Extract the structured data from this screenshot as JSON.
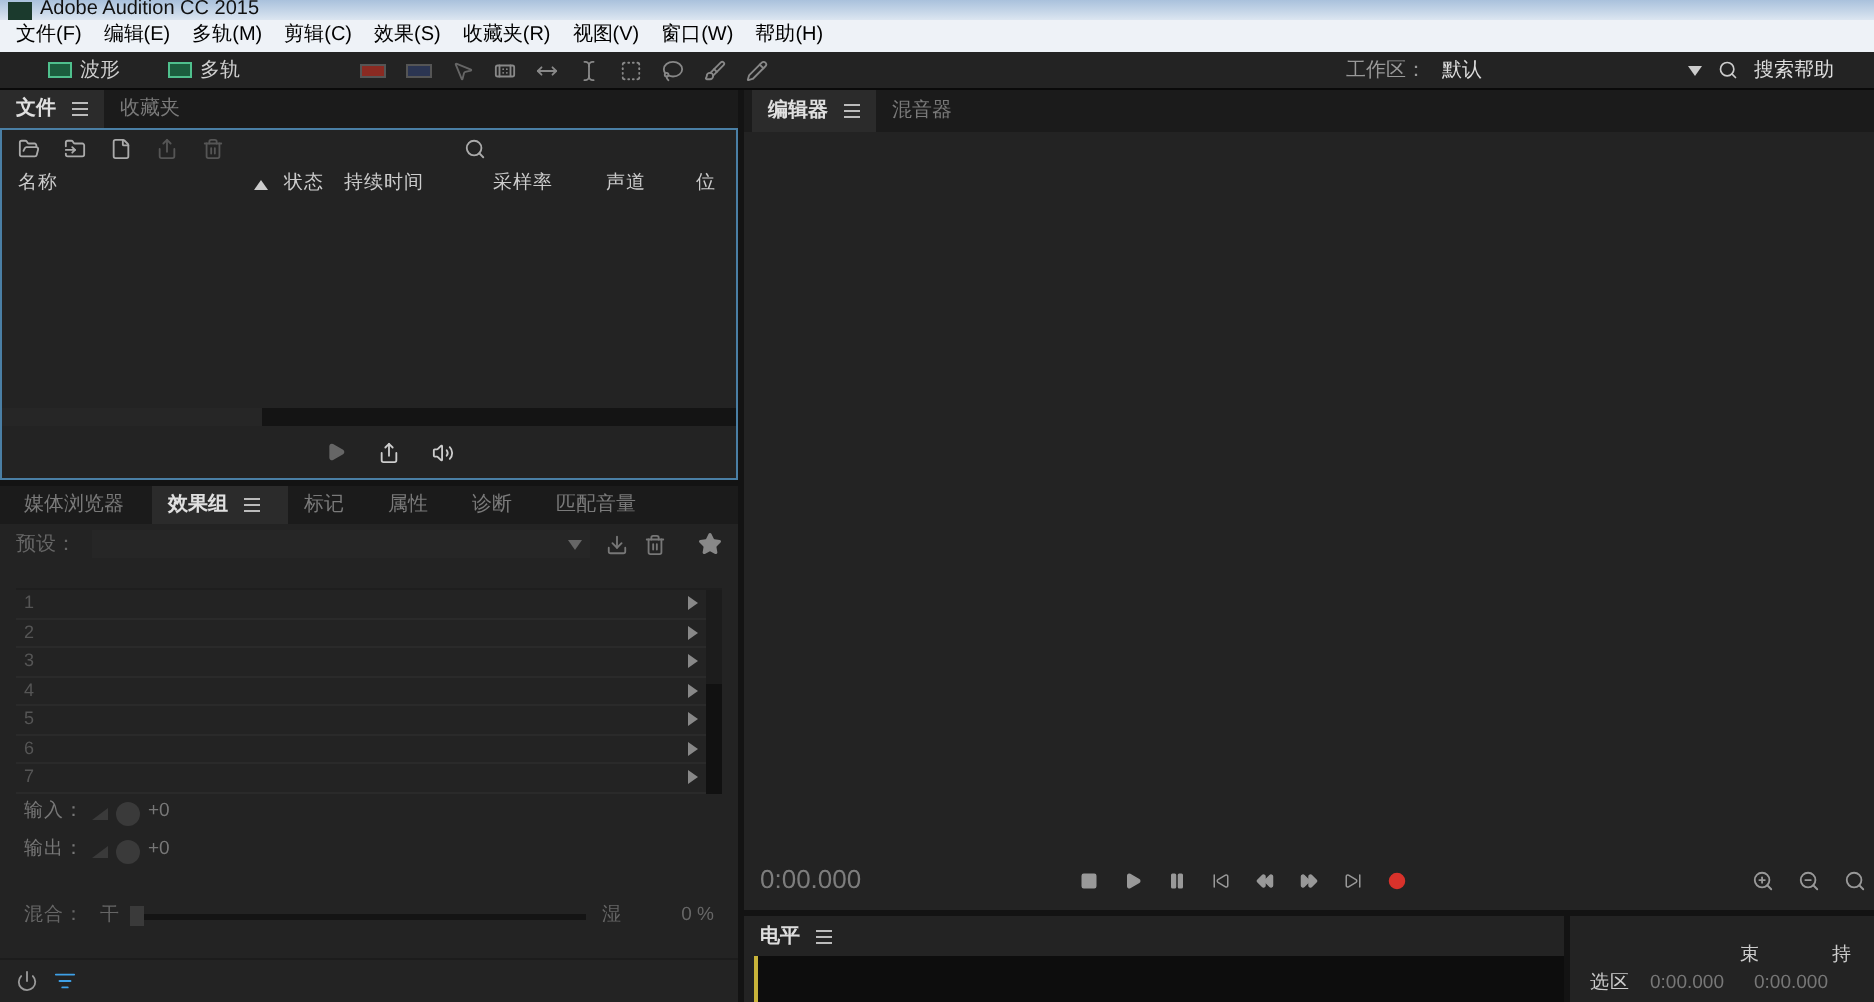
{
  "window": {
    "title": "Adobe Audition CC 2015"
  },
  "menu": [
    "文件(F)",
    "编辑(E)",
    "多轨(M)",
    "剪辑(C)",
    "效果(S)",
    "收藏夹(R)",
    "视图(V)",
    "窗口(W)",
    "帮助(H)"
  ],
  "toolbar": {
    "modes": [
      {
        "label": "波形",
        "selected": false
      },
      {
        "label": "多轨",
        "selected": false
      }
    ],
    "workspace_label": "工作区：",
    "workspace_value": "默认",
    "search_label": "搜索帮助"
  },
  "files_panel": {
    "tabs": [
      {
        "label": "文件",
        "selected": true
      },
      {
        "label": "收藏夹",
        "selected": false
      }
    ],
    "columns": [
      "名称",
      "状态",
      "持续时间",
      "采样率",
      "声道",
      "位"
    ]
  },
  "effects_panel": {
    "tabs": [
      {
        "label": "媒体浏览器",
        "selected": false
      },
      {
        "label": "效果组",
        "selected": true
      },
      {
        "label": "标记",
        "selected": false
      },
      {
        "label": "属性",
        "selected": false
      },
      {
        "label": "诊断",
        "selected": false
      },
      {
        "label": "匹配音量",
        "selected": false
      }
    ],
    "preset_label": "预设：",
    "slots": [
      "1",
      "2",
      "3",
      "4",
      "5",
      "6",
      "7"
    ],
    "input_label": "输入：",
    "input_value": "+0",
    "output_label": "输出：",
    "output_value": "+0",
    "mix_label": "混合：",
    "mix_dry": "干",
    "mix_wet": "湿",
    "mix_value": "0 %",
    "mix": {
      "level": 0
    }
  },
  "editor_panel": {
    "tabs": [
      {
        "label": "编辑器",
        "selected": true
      },
      {
        "label": "混音器",
        "selected": false
      }
    ],
    "time": "0:00.000"
  },
  "levels_panel": {
    "title": "电平"
  },
  "selection_panel": {
    "columns": [
      "束",
      "持"
    ],
    "rows": [
      {
        "label": "选区",
        "values": [
          "0:00.000",
          "0:00.000"
        ]
      }
    ]
  }
}
